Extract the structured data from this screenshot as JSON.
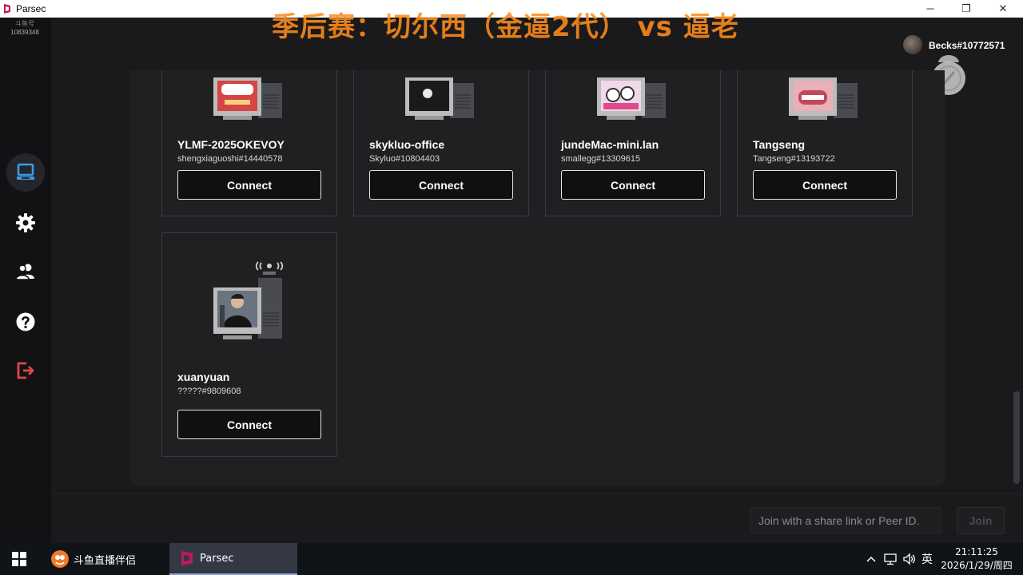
{
  "window": {
    "title": "Parsec",
    "minimize": "─",
    "maximize": "❐",
    "close": "✕"
  },
  "overlay": {
    "badge_line1": "斗鱼号",
    "badge_line2": "10839348",
    "headline": "季后赛：切尔西（金逼2代） vs 逼老"
  },
  "sidebar": {
    "items": [
      {
        "name": "computers",
        "icon": "computer-icon",
        "active": true
      },
      {
        "name": "settings",
        "icon": "gear-icon",
        "active": false
      },
      {
        "name": "friends",
        "icon": "users-icon",
        "active": false
      },
      {
        "name": "help",
        "icon": "help-icon",
        "active": false
      },
      {
        "name": "logout",
        "icon": "logout-icon",
        "active": false
      }
    ],
    "accent_active": "#3b9ce8",
    "accent_logout": "#e0454d"
  },
  "user": {
    "name": "Becks#10772571"
  },
  "computers": [
    {
      "name": "YLMF-2025OKEVOY",
      "peer": "shengxiaguoshi#14440578",
      "connect": "Connect"
    },
    {
      "name": "skykluo-office",
      "peer": "Skyluo#10804403",
      "connect": "Connect"
    },
    {
      "name": "jundeMac-mini.lan",
      "peer": "smallegg#13309615",
      "connect": "Connect"
    },
    {
      "name": "Tangseng",
      "peer": "Tangseng#13193722",
      "connect": "Connect"
    },
    {
      "name": "xuanyuan",
      "peer": "?????#9809608",
      "connect": "Connect"
    }
  ],
  "join": {
    "placeholder": "Join with a share link or Peer ID.",
    "button": "Join"
  },
  "taskbar": {
    "apps": [
      {
        "label": "斗鱼直播伴侣",
        "active": false
      },
      {
        "label": "Parsec",
        "active": true
      }
    ],
    "tray": {
      "chevron": "^",
      "ime": "英"
    },
    "time": "21:11:25",
    "date": "2026/1/29/周四"
  }
}
